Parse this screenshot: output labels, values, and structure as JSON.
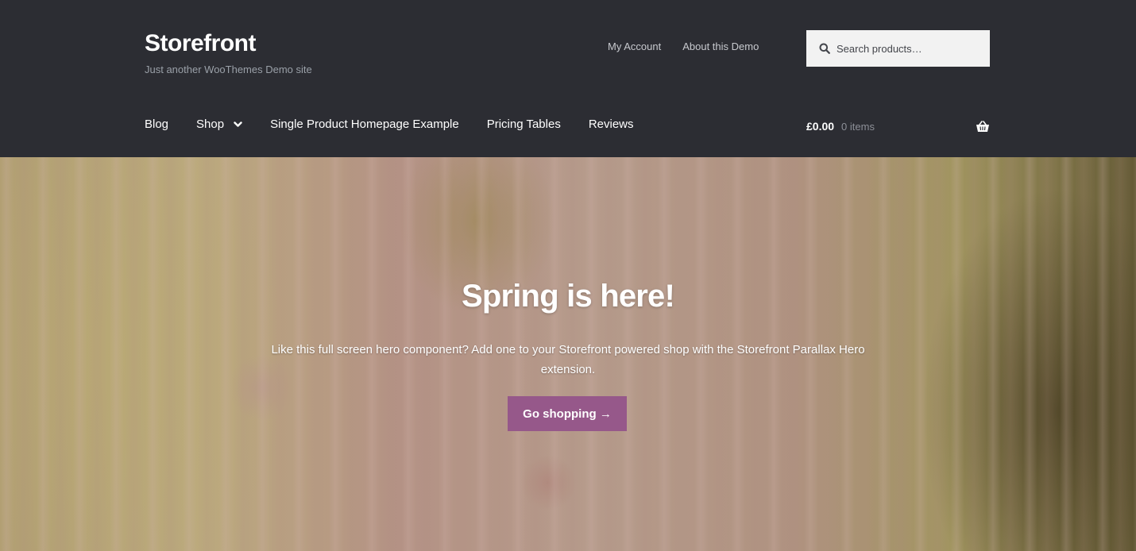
{
  "site": {
    "title": "Storefront",
    "tagline": "Just another WooThemes Demo site"
  },
  "secondary_nav": {
    "items": [
      {
        "label": "My Account"
      },
      {
        "label": "About this Demo"
      }
    ]
  },
  "search": {
    "placeholder": "Search products…",
    "icon": "search-icon"
  },
  "primary_nav": {
    "items": [
      {
        "label": "Blog"
      },
      {
        "label": "Shop",
        "icon": "chevron-down-icon"
      },
      {
        "label": "Single Product Homepage Example"
      },
      {
        "label": "Pricing Tables"
      },
      {
        "label": "Reviews"
      }
    ]
  },
  "cart": {
    "amount": "£0.00",
    "count": "0 items",
    "icon": "basket-icon"
  },
  "hero": {
    "title": "Spring is here!",
    "text": "Like this full screen hero component? Add one to your Storefront powered shop with the Storefront Parallax Hero extension.",
    "button_label": "Go shopping →"
  },
  "colors": {
    "header_bg": "#2c2d33",
    "accent": "#96588a",
    "search_bg": "#f2f2f2"
  }
}
